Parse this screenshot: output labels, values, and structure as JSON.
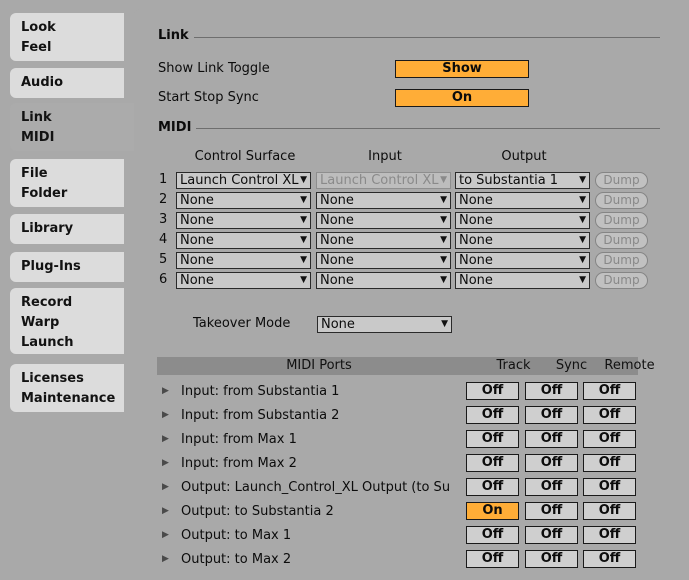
{
  "sidebar": {
    "tabs": [
      {
        "lines": [
          "Look",
          "Feel"
        ]
      },
      {
        "lines": [
          "Audio"
        ]
      },
      {
        "lines": [
          "Link",
          "MIDI"
        ]
      },
      {
        "lines": [
          "File",
          "Folder"
        ]
      },
      {
        "lines": [
          "Library"
        ]
      },
      {
        "lines": [
          "Plug-Ins"
        ]
      },
      {
        "lines": [
          "Record",
          "Warp",
          "Launch"
        ]
      },
      {
        "lines": [
          "Licenses",
          "Maintenance"
        ]
      }
    ],
    "active_index": 2
  },
  "link": {
    "section_title": "Link",
    "show_link_toggle_label": "Show Link Toggle",
    "show_link_toggle_value": "Show",
    "start_stop_sync_label": "Start Stop Sync",
    "start_stop_sync_value": "On"
  },
  "midi": {
    "section_title": "MIDI",
    "col_control_surface": "Control Surface",
    "col_input": "Input",
    "col_output": "Output",
    "rows": [
      {
        "num": "1",
        "surface": "Launch Control XL",
        "input": "Launch Control XL",
        "output": "to Substantia 1",
        "dump": "Dump"
      },
      {
        "num": "2",
        "surface": "None",
        "input": "None",
        "output": "None",
        "dump": "Dump"
      },
      {
        "num": "3",
        "surface": "None",
        "input": "None",
        "output": "None",
        "dump": "Dump"
      },
      {
        "num": "4",
        "surface": "None",
        "input": "None",
        "output": "None",
        "dump": "Dump"
      },
      {
        "num": "5",
        "surface": "None",
        "input": "None",
        "output": "None",
        "dump": "Dump"
      },
      {
        "num": "6",
        "surface": "None",
        "input": "None",
        "output": "None",
        "dump": "Dump"
      }
    ],
    "takeover_label": "Takeover Mode",
    "takeover_value": "None"
  },
  "ports": {
    "header_ports": "MIDI Ports",
    "header_track": "Track",
    "header_sync": "Sync",
    "header_remote": "Remote",
    "rows": [
      {
        "label": "Input:   from Substantia 1",
        "track": "Off",
        "sync": "Off",
        "remote": "Off",
        "track_on": false
      },
      {
        "label": "Input:   from Substantia 2",
        "track": "Off",
        "sync": "Off",
        "remote": "Off",
        "track_on": false
      },
      {
        "label": "Input:   from Max 1",
        "track": "Off",
        "sync": "Off",
        "remote": "Off",
        "track_on": false
      },
      {
        "label": "Input:   from Max 2",
        "track": "Off",
        "sync": "Off",
        "remote": "Off",
        "track_on": false
      },
      {
        "label": "Output: Launch_Control_XL Output (to Su",
        "track": "Off",
        "sync": "Off",
        "remote": "Off",
        "track_on": false
      },
      {
        "label": "Output: to Substantia 2",
        "track": "On",
        "sync": "Off",
        "remote": "Off",
        "track_on": true
      },
      {
        "label": "Output: to Max 1",
        "track": "Off",
        "sync": "Off",
        "remote": "Off",
        "track_on": false
      },
      {
        "label": "Output: to Max 2",
        "track": "Off",
        "sync": "Off",
        "remote": "Off",
        "track_on": false
      }
    ]
  },
  "colors": {
    "accent_on": "#ffad37",
    "panel": "#a9a9a9",
    "tab": "#dcdcdc"
  }
}
